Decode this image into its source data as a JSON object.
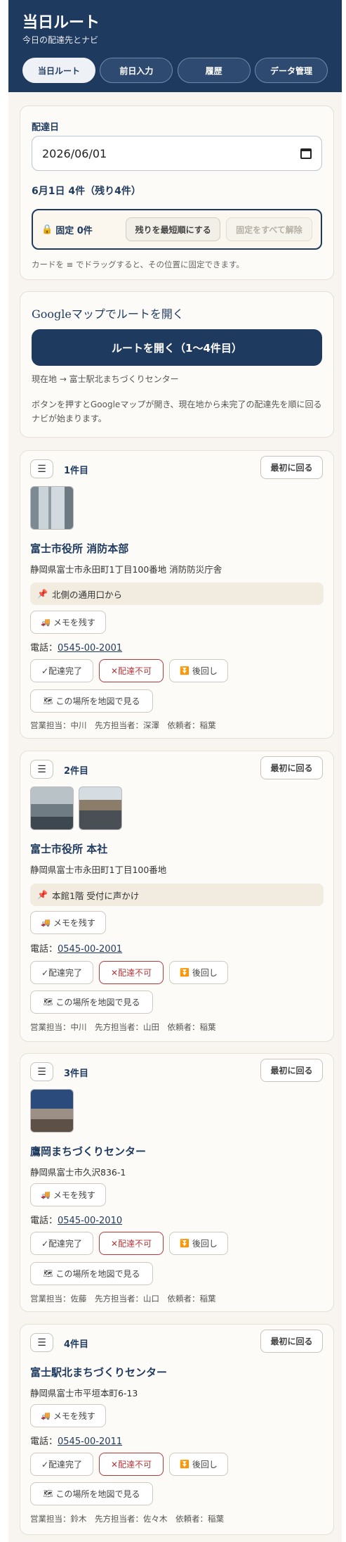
{
  "header": {
    "title": "当日ルート",
    "subtitle": "今日の配達先とナビ"
  },
  "nav": [
    "当日ルート",
    "前日入力",
    "履歴",
    "データ管理"
  ],
  "date_card": {
    "label": "配達日",
    "date_value": "2026/06/01",
    "summary": "6月1日 4件（残り4件）",
    "fixed_count": "固定 0件",
    "shortest_btn": "残りを最短順にする",
    "clear_btn": "固定をすべて解除",
    "hint": "カードを ≡ でドラッグすると、その位置に固定できます。"
  },
  "gmap_card": {
    "title": "Googleマップでルートを開く",
    "open_btn": "ルートを開く（1〜4件目）",
    "route": "現在地 → 富士駅北まちづくりセンター",
    "desc": "ボタンを押すとGoogleマップが開き、現在地から未完了の配達先を順に回るナビが始まります。"
  },
  "common": {
    "first_btn": "最初に回る",
    "memo_btn": "メモを残す",
    "tel_label": "電話：",
    "done_btn": "✓配達完了",
    "ng_btn": "✕配達不可",
    "later_btn": "後回し",
    "map_btn": "この場所を地図で見る"
  },
  "stops": [
    {
      "order": "1件目",
      "name": "富士市役所 消防本部",
      "address": "静岡県富士市永田町1丁目100番地 消防防災庁舎",
      "note": "北側の通用口から",
      "phone": "0545-00-2001",
      "staff": "営業担当：中川　先方担当者：深澤　依頼者：稲葉"
    },
    {
      "order": "2件目",
      "name": "富士市役所 本社",
      "address": "静岡県富士市永田町1丁目100番地",
      "note": "本館1階 受付に声かけ",
      "phone": "0545-00-2001",
      "staff": "営業担当：中川　先方担当者：山田　依頼者：稲葉"
    },
    {
      "order": "3件目",
      "name": "鷹岡まちづくりセンター",
      "address": "静岡県富士市久沢836-1",
      "note": "",
      "phone": "0545-00-2010",
      "staff": "営業担当：佐藤　先方担当者：山口　依頼者：稲葉"
    },
    {
      "order": "4件目",
      "name": "富士駅北まちづくりセンター",
      "address": "静岡県富士市平垣本町6-13",
      "note": "",
      "phone": "0545-00-2011",
      "staff": "営業担当：鈴木　先方担当者：佐々木　依頼者：稲葉"
    }
  ]
}
